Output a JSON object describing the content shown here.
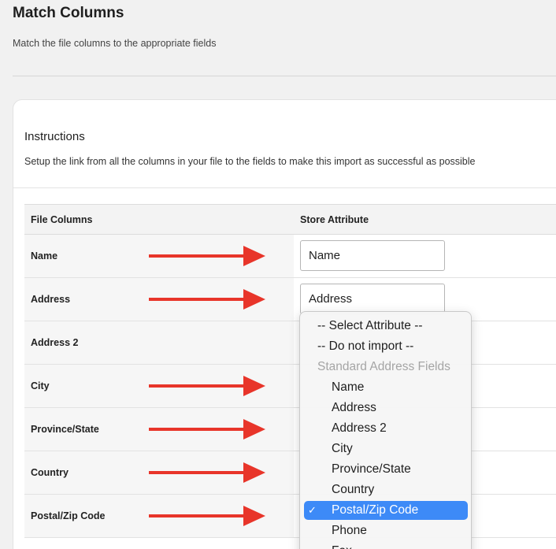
{
  "header": {
    "title": "Match Columns",
    "subtitle": "Match the file columns to the appropriate fields"
  },
  "instructions": {
    "title": "Instructions",
    "description": "Setup the link from all the columns in your file to the fields to make this import as successful as possible"
  },
  "table": {
    "headers": [
      "File Columns",
      "Store Attribute"
    ],
    "rows": [
      {
        "label": "Name",
        "value": "Name",
        "arrow": true
      },
      {
        "label": "Address",
        "value": "Address",
        "arrow": true
      },
      {
        "label": "Address 2",
        "value": "",
        "arrow": false
      },
      {
        "label": "City",
        "value": "",
        "arrow": true
      },
      {
        "label": "Province/State",
        "value": "",
        "arrow": true
      },
      {
        "label": "Country",
        "value": "",
        "arrow": true
      },
      {
        "label": "Postal/Zip Code",
        "value": "",
        "arrow": true
      }
    ]
  },
  "dropdown": {
    "top_options": [
      "-- Select Attribute --",
      "-- Do not import --"
    ],
    "group_label": "Standard Address Fields",
    "options": [
      "Name",
      "Address",
      "Address 2",
      "City",
      "Province/State",
      "Country",
      "Postal/Zip Code",
      "Phone",
      "Fax"
    ],
    "selected": "Postal/Zip Code",
    "check_glyph": "✓"
  },
  "colors": {
    "arrow": "#e8352a",
    "selected_bg": "#3d8af7"
  }
}
